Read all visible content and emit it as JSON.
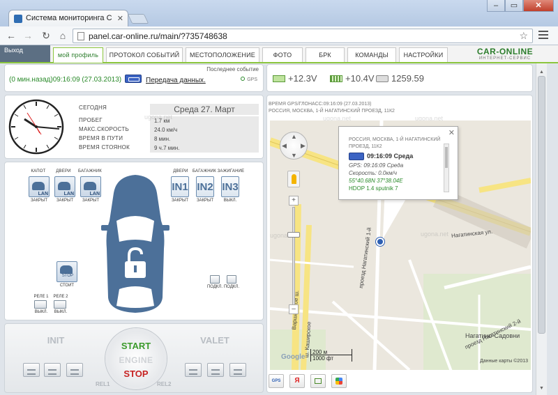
{
  "browser": {
    "tab_title": "Система мониторинга С",
    "tab_close": "✕",
    "url": "panel.car-online.ru/main/?735748638",
    "win_min": "–",
    "win_max": "▭",
    "win_close": "✕"
  },
  "site": {
    "logout": "Выход",
    "tabs": [
      "мой профиль",
      "ПРОТОКОЛ СОБЫТИЙ",
      "МЕСТОПОЛОЖЕНИЕ",
      "ФОТО",
      "БРК",
      "КОМАНДЫ",
      "НАСТРОЙКИ"
    ],
    "brand_name": "CAR-ONLINE",
    "brand_sub": "ИНТЕРНЕТ-СЕРВИС"
  },
  "status": {
    "time": "(0 мин.назад)09:16:09 (27.03.2013)",
    "link": "Передача данных.",
    "last_event": "Последнее событие",
    "gps": "GPS"
  },
  "power": {
    "battery_main": "+12.3V",
    "battery_backup": "+10.4V",
    "odometer": "1259.59"
  },
  "info": {
    "rows": [
      {
        "label": "СЕГОДНЯ",
        "value": "Среда 27. Март"
      },
      {
        "label": "ПРОБЕГ",
        "value": "1.7 км"
      },
      {
        "label": "МАКС.СКОРОСТЬ",
        "value": "24.0 км/ч"
      },
      {
        "label": "ВРЕМЯ В ПУТИ",
        "value": "8 мин."
      },
      {
        "label": "ВРЕМЯ СТОЯНОК",
        "value": "9 ч.7 мин."
      }
    ]
  },
  "sensors": {
    "hood_label": "КАПОТ",
    "hood_state": "ЗАКРЫТ",
    "doors_label": "ДВЕРИ",
    "doors_state": "ЗАКРЫТ",
    "trunk_label": "БАГАЖНИК",
    "trunk_state": "ЗАКРЫТ",
    "in1_title": "ДВЕРИ",
    "in1": "IN1",
    "in1_state": "ЗАКРЫТ",
    "in2_title": "БАГАЖНИК",
    "in2": "IN2",
    "in2_state": "ЗАКРЫТ",
    "in3_title": "ЗАЖИГАНИЕ",
    "in3": "IN3",
    "in3_state": "ВЫКЛ.",
    "stop_label": "STOP",
    "stop_state": "СТОИТ",
    "rele1_label": "РЕЛЕ 1",
    "rele1_state": "ВЫКЛ.",
    "rele2_label": "РЕЛЕ 2",
    "rele2_state": "ВЫКЛ.",
    "con1_state": "ПОДКЛ.",
    "con2_state": "ПОДКЛ."
  },
  "engine": {
    "init": "INIT",
    "valet": "VALET",
    "start": "START",
    "engine": "ENGINE",
    "stop": "STOP",
    "rel1": "REL1",
    "rel2": "REL2"
  },
  "map": {
    "head_line1": "ВРЕМЯ GPS/ГЛОНАСС:09:16:09 (27.03.2013)",
    "head_line2": "РОССИЯ, МОСКВА, 1-Й НАГАТИНСКИЙ ПРОЕЗД, 11К2",
    "street1": "Нагатинская ул.",
    "street2": "проезд Нагатинский 1-й",
    "street3": "Варшавское ш.",
    "street4": "ш. Каширское",
    "street5": "проезд Нагатинский 2-й",
    "district": "Нагатино-Садовни",
    "scale_m": "200 м",
    "scale_ft": "1000 фт",
    "copyright": "Данные карты ©2013",
    "google": "Google",
    "watermark": "ugona.net",
    "zoom_in": "+",
    "zoom_out": "–",
    "bubble": {
      "address": "РОССИЯ, МОСКВА, 1-Й НАГАТИНСКИЙ ПРОЕЗД, 11К2",
      "title": "09:16:09 Среда",
      "gps": "GPS: 09:16:09 Среда",
      "speed": "Скорость: 0.0км/ч",
      "coords": "55°40.68N  37°38.04E",
      "hdop": "HDOP 1.4  sputnik 7",
      "close": "✕"
    },
    "tools": [
      "GPS",
      "Я",
      "",
      ""
    ]
  },
  "colors": {
    "accent_green": "#8cc63e",
    "car_blue": "#4c7099",
    "start_green": "#3b9a2b",
    "stop_red": "#c62222"
  }
}
